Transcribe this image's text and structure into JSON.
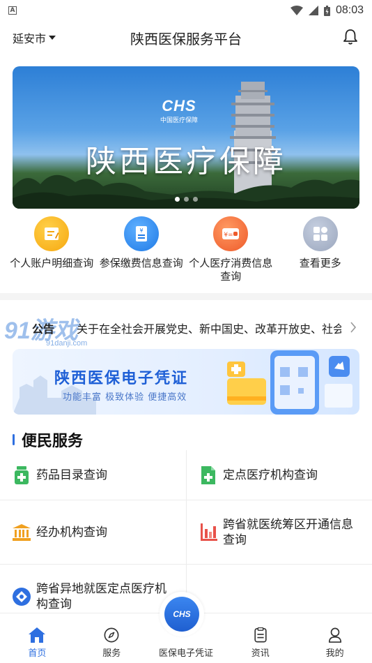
{
  "status_bar": {
    "time": "08:03",
    "indicator": "A"
  },
  "header": {
    "city": "延安市",
    "title": "陕西医保服务平台"
  },
  "banner": {
    "logo_text": "CHS",
    "logo_subtitle": "中国医疗保障",
    "headline": "陕西医疗保障",
    "slide_count": 3,
    "active_slide": 1
  },
  "quick_actions": [
    {
      "label": "个人账户明细查询",
      "icon": "document-icon",
      "color": "#f6b21a"
    },
    {
      "label": "参保缴费信息查询",
      "icon": "receipt-icon",
      "color": "#2e86ee"
    },
    {
      "label": "个人医疗消费信息查询",
      "icon": "wallet-icon",
      "color": "#f26a3a"
    },
    {
      "label": "查看更多",
      "icon": "grid-icon",
      "color": "#9aa6bd"
    }
  ],
  "notice": {
    "tag": "公告",
    "text": "关于在全社会开展党史、新中国史、改革开放史、社会主义发展史宣传教育的通知",
    "watermark": "91游戏",
    "watermark_url": "91danji.com"
  },
  "promo": {
    "title": "陕西医保电子凭证",
    "subtitle": "功能丰富    极致体验    便捷高效"
  },
  "service_section": {
    "title": "便民服务",
    "items": [
      {
        "label": "药品目录查询",
        "icon": "medicine-box-icon",
        "color": "#3cb860"
      },
      {
        "label": "定点医疗机构查询",
        "icon": "medical-file-icon",
        "color": "#3cb860"
      },
      {
        "label": "经办机构查询",
        "icon": "institution-icon",
        "color": "#f0a020"
      },
      {
        "label": "跨省就医统筹区开通信息查询",
        "icon": "bar-chart-icon",
        "color": "#e8524a"
      },
      {
        "label": "跨省异地就医定点医疗机构查询",
        "icon": "location-diamond-icon",
        "color": "#2e6fe0"
      },
      {
        "label": "",
        "icon": "",
        "color": ""
      }
    ]
  },
  "bottom_nav": {
    "items": [
      {
        "label": "首页",
        "icon": "home-icon",
        "active": true
      },
      {
        "label": "服务",
        "icon": "compass-icon",
        "active": false
      },
      {
        "label": "医保电子凭证",
        "icon": "chs-scan-icon",
        "active": false
      },
      {
        "label": "资讯",
        "icon": "news-icon",
        "active": false
      },
      {
        "label": "我的",
        "icon": "user-icon",
        "active": false
      }
    ],
    "center_text": "CHS"
  },
  "colors": {
    "accent": "#2e6fe0",
    "text": "#222222",
    "divider": "#ececec"
  }
}
